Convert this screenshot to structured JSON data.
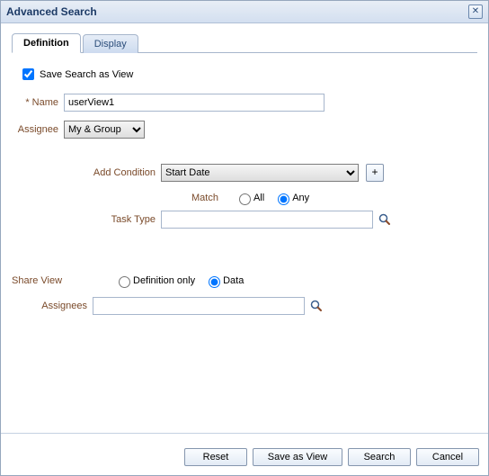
{
  "title": "Advanced Search",
  "tabs": {
    "definition": "Definition",
    "display": "Display"
  },
  "save_as_view": {
    "label": "Save Search as View",
    "checked": true
  },
  "name": {
    "label": "Name",
    "value": "userView1"
  },
  "assignee": {
    "label": "Assignee",
    "selected": "My & Group"
  },
  "add_condition": {
    "label": "Add Condition",
    "selected": "Start Date"
  },
  "match": {
    "label": "Match",
    "all": "All",
    "any": "Any",
    "selected": "any"
  },
  "task_type": {
    "label": "Task Type",
    "value": ""
  },
  "share_view": {
    "label": "Share View",
    "def_only": "Definition only",
    "data": "Data",
    "selected": "data"
  },
  "assignees": {
    "label": "Assignees",
    "value": ""
  },
  "buttons": {
    "reset": "Reset",
    "save_as_view": "Save as View",
    "search": "Search",
    "cancel": "Cancel"
  }
}
